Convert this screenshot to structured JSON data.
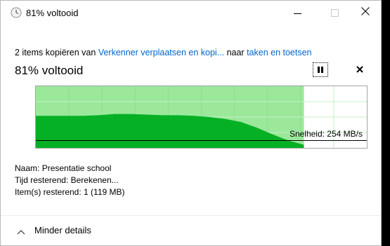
{
  "window": {
    "title": "81% voltooid",
    "icon": "clock-icon"
  },
  "controls": {
    "minimize": "minimize-icon",
    "maximize": "maximize-icon",
    "close": "close-icon"
  },
  "status": {
    "prefix": "2 items kopiëren van ",
    "source": "Verkenner verplaatsen en kopi...",
    "middle": " naar ",
    "destination": "taken en toetsen"
  },
  "progress": {
    "heading": "81% voltooid",
    "percent": 81,
    "speed_text": "Snelheid: 254 MB/s",
    "pause": "pause-icon",
    "cancel": "cancel-icon"
  },
  "graph_data": {
    "fill_fraction": 0.81,
    "light_green": "#9be89b",
    "dark_green": "#06b025",
    "grid_color": "#c5f0c5",
    "speed_line_fraction": 0.88,
    "speed_profile": [
      0.52,
      0.52,
      0.52,
      0.52,
      0.53,
      0.55,
      0.55,
      0.54,
      0.53,
      0.53,
      0.52,
      0.5,
      0.47,
      0.42,
      0.33,
      0.22,
      0.12,
      0.05
    ]
  },
  "details": {
    "name_label": "Naam:",
    "name_value": "Presentatie school",
    "time_label": "Tijd resterend:",
    "time_value": "Berekenen...",
    "items_label": "Item(s) resterend:",
    "items_value": "1 (119 MB)"
  },
  "footer": {
    "toggle_label": "Minder details",
    "icon": "chevron-up-icon"
  }
}
